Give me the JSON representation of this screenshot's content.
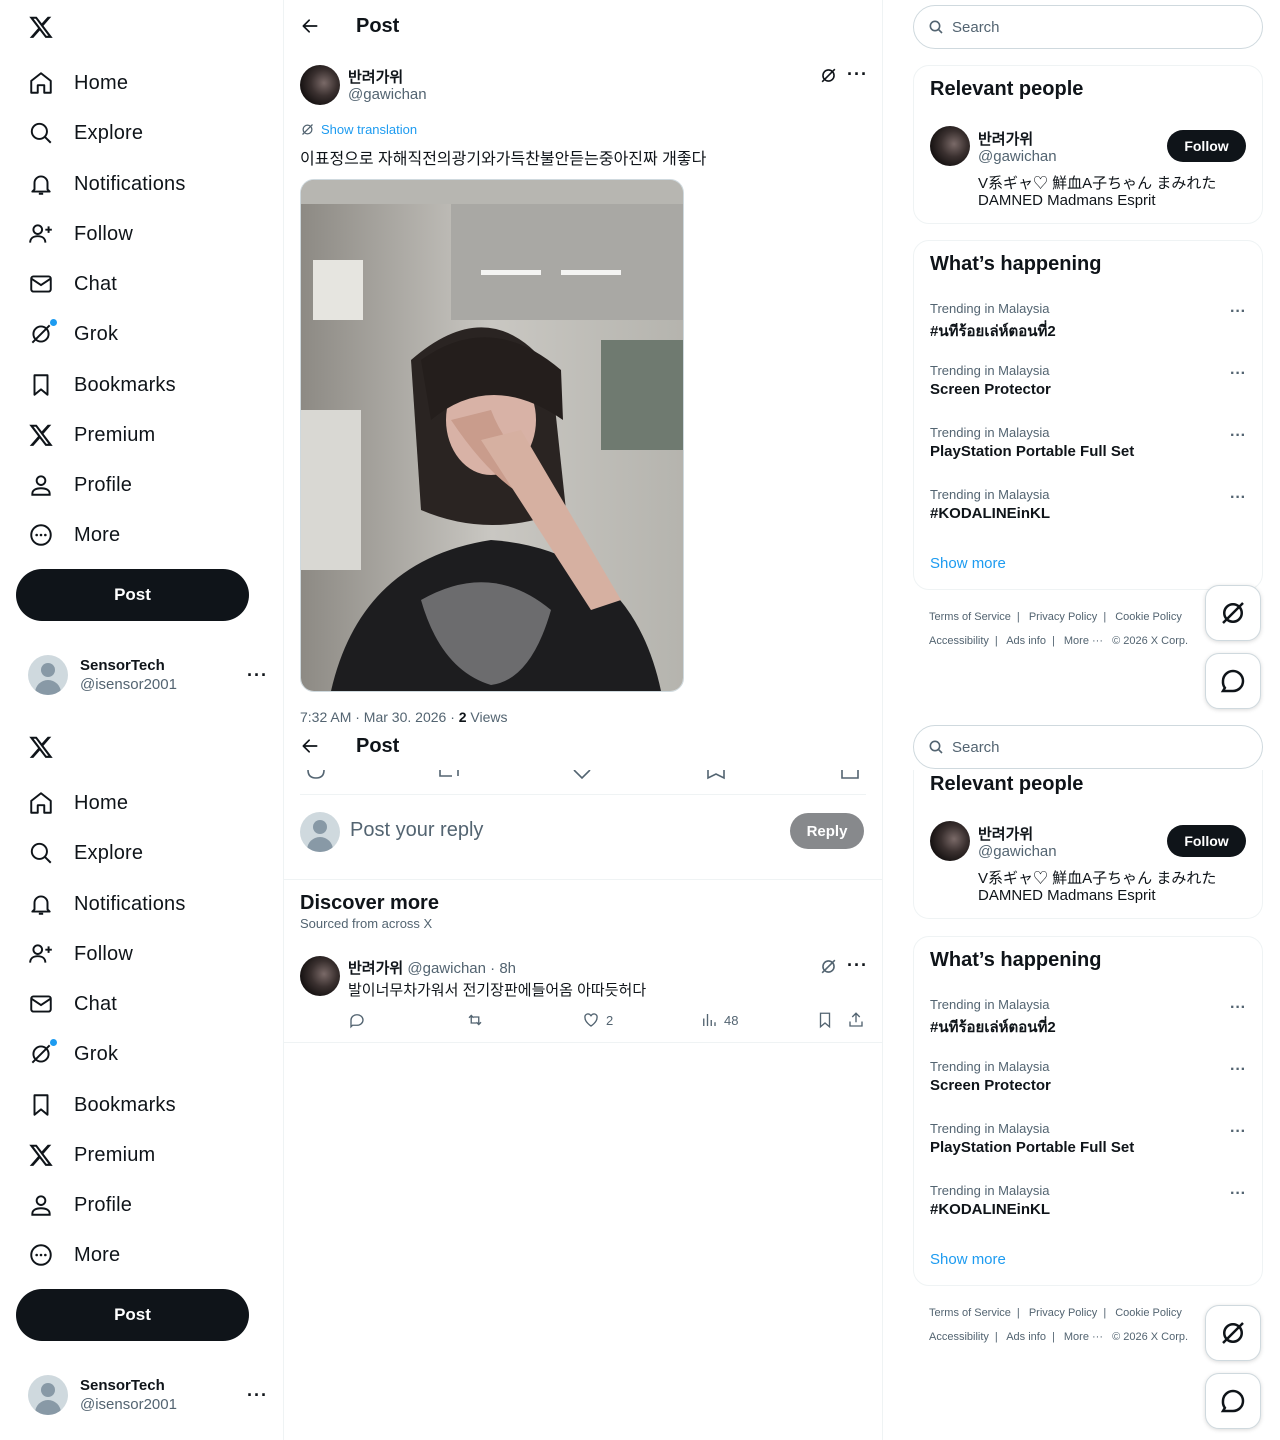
{
  "nav": {
    "items": [
      {
        "label": "Home"
      },
      {
        "label": "Explore"
      },
      {
        "label": "Notifications"
      },
      {
        "label": "Follow"
      },
      {
        "label": "Chat"
      },
      {
        "label": "Grok"
      },
      {
        "label": "Bookmarks"
      },
      {
        "label": "Premium"
      },
      {
        "label": "Profile"
      },
      {
        "label": "More"
      }
    ],
    "post_label": "Post"
  },
  "account": {
    "name": "SensorTech",
    "handle": "@isensor2001"
  },
  "header": {
    "title": "Post"
  },
  "post": {
    "author_name": "반려가위",
    "author_handle": "@gawichan",
    "show_translation": "Show translation",
    "text": "이표정으로 자해직전의광기와가득찬불안듣는중아진짜 개좋다",
    "meta_time": "7:32 AM · Mar 30, 2026 · ",
    "meta_views_count": "2",
    "meta_views_label": " Views"
  },
  "reply": {
    "placeholder": "Post your reply",
    "button": "Reply"
  },
  "discover": {
    "title": "Discover more",
    "subtitle": "Sourced from across X",
    "post": {
      "author_name": "반려가위",
      "author_handle": "@gawichan",
      "time": "· 8h",
      "text": "발이너무차가워서 전기장판에들어옴 아따듯허다",
      "likes": "2",
      "views": "48"
    }
  },
  "sidebar": {
    "search_placeholder": "Search",
    "relevant": {
      "title": "Relevant people",
      "name": "반려가위",
      "handle": "@gawichan",
      "follow": "Follow",
      "bio_line1": "V系ギャ♡ 鮮血A子ちゃん まみれた",
      "bio_line2": "DAMNED Madmans Esprit"
    },
    "happening": {
      "title": "What’s happening",
      "trends": [
        {
          "context": "Trending in Malaysia",
          "title": "#นทีร้อยเล่ห์ตอนที่2"
        },
        {
          "context": "Trending in Malaysia",
          "title": "Screen Protector"
        },
        {
          "context": "Trending in Malaysia",
          "title": "PlayStation Portable Full Set"
        },
        {
          "context": "Trending in Malaysia",
          "title": "#KODALINEinKL"
        }
      ],
      "show_more": "Show more"
    },
    "footer": {
      "terms": "Terms of Service",
      "privacy": "Privacy Policy",
      "cookie": "Cookie Policy",
      "accessibility": "Accessibility",
      "ads": "Ads info",
      "more": "More ···",
      "copyright": "© 2026 X Corp."
    }
  }
}
